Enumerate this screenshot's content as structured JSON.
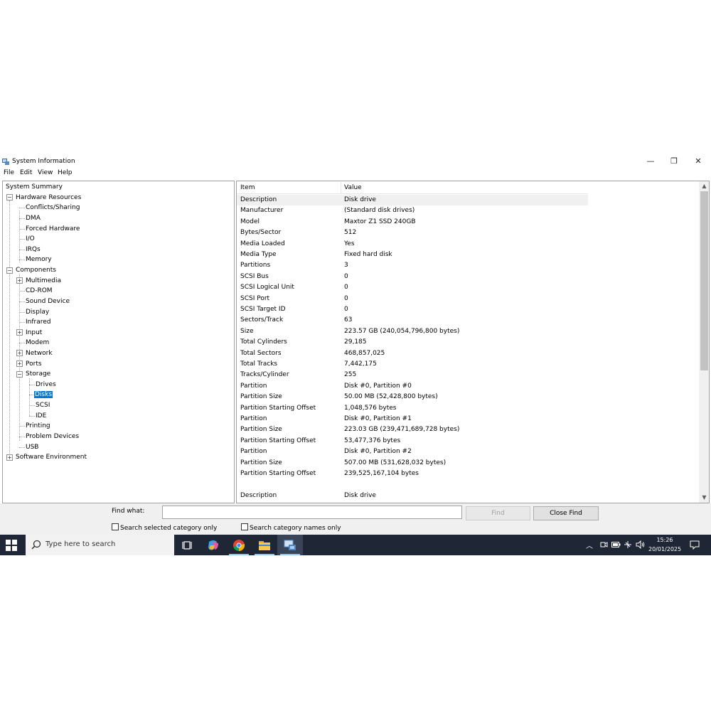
{
  "window": {
    "title": "System Information",
    "controls": {
      "minimize": "—",
      "maximize": "❐",
      "close": "✕"
    }
  },
  "menu": [
    "File",
    "Edit",
    "View",
    "Help"
  ],
  "tree": {
    "root": "System Summary",
    "hardware_resources": {
      "label": "Hardware Resources",
      "children": [
        "Conflicts/Sharing",
        "DMA",
        "Forced Hardware",
        "I/O",
        "IRQs",
        "Memory"
      ]
    },
    "components": {
      "label": "Components",
      "multimedia": "Multimedia",
      "cdrom": "CD-ROM",
      "sound": "Sound Device",
      "display": "Display",
      "infrared": "Infrared",
      "input": "Input",
      "modem": "Modem",
      "network": "Network",
      "ports": "Ports",
      "storage": {
        "label": "Storage",
        "children": [
          "Drives",
          "Disks",
          "SCSI",
          "IDE"
        ],
        "selected": "Disks"
      },
      "printing": "Printing",
      "problem_devices": "Problem Devices",
      "usb": "USB"
    },
    "software_environment": "Software Environment"
  },
  "detail": {
    "columns": {
      "item": "Item",
      "value": "Value"
    },
    "rows": [
      {
        "item": "Description",
        "value": "Disk drive"
      },
      {
        "item": "Manufacturer",
        "value": "(Standard disk drives)"
      },
      {
        "item": "Model",
        "value": "Maxtor Z1 SSD 240GB"
      },
      {
        "item": "Bytes/Sector",
        "value": "512"
      },
      {
        "item": "Media Loaded",
        "value": "Yes"
      },
      {
        "item": "Media Type",
        "value": "Fixed hard disk"
      },
      {
        "item": "Partitions",
        "value": "3"
      },
      {
        "item": "SCSI Bus",
        "value": "0"
      },
      {
        "item": "SCSI Logical Unit",
        "value": "0"
      },
      {
        "item": "SCSI Port",
        "value": "0"
      },
      {
        "item": "SCSI Target ID",
        "value": "0"
      },
      {
        "item": "Sectors/Track",
        "value": "63"
      },
      {
        "item": "Size",
        "value": "223.57 GB (240,054,796,800 bytes)"
      },
      {
        "item": "Total Cylinders",
        "value": "29,185"
      },
      {
        "item": "Total Sectors",
        "value": "468,857,025"
      },
      {
        "item": "Total Tracks",
        "value": "7,442,175"
      },
      {
        "item": "Tracks/Cylinder",
        "value": "255"
      },
      {
        "item": "Partition",
        "value": "Disk #0, Partition #0"
      },
      {
        "item": "Partition Size",
        "value": "50.00 MB (52,428,800 bytes)"
      },
      {
        "item": "Partition Starting Offset",
        "value": "1,048,576 bytes"
      },
      {
        "item": "Partition",
        "value": "Disk #0, Partition #1"
      },
      {
        "item": "Partition Size",
        "value": "223.03 GB (239,471,689,728 bytes)"
      },
      {
        "item": "Partition Starting Offset",
        "value": "53,477,376 bytes"
      },
      {
        "item": "Partition",
        "value": "Disk #0, Partition #2"
      },
      {
        "item": "Partition Size",
        "value": "507.00 MB (531,628,032 bytes)"
      },
      {
        "item": "Partition Starting Offset",
        "value": "239,525,167,104 bytes"
      },
      {
        "item": "",
        "value": ""
      },
      {
        "item": "Description",
        "value": "Disk drive"
      }
    ]
  },
  "find": {
    "label": "Find what:",
    "value": "",
    "find_button": "Find",
    "close_button": "Close Find",
    "search_selected": "Search selected category only",
    "search_names": "Search category names only"
  },
  "taskbar": {
    "search_placeholder": "Type here to search",
    "time": "15:26",
    "date": "20/01/2025",
    "accent": "#0078d7"
  }
}
